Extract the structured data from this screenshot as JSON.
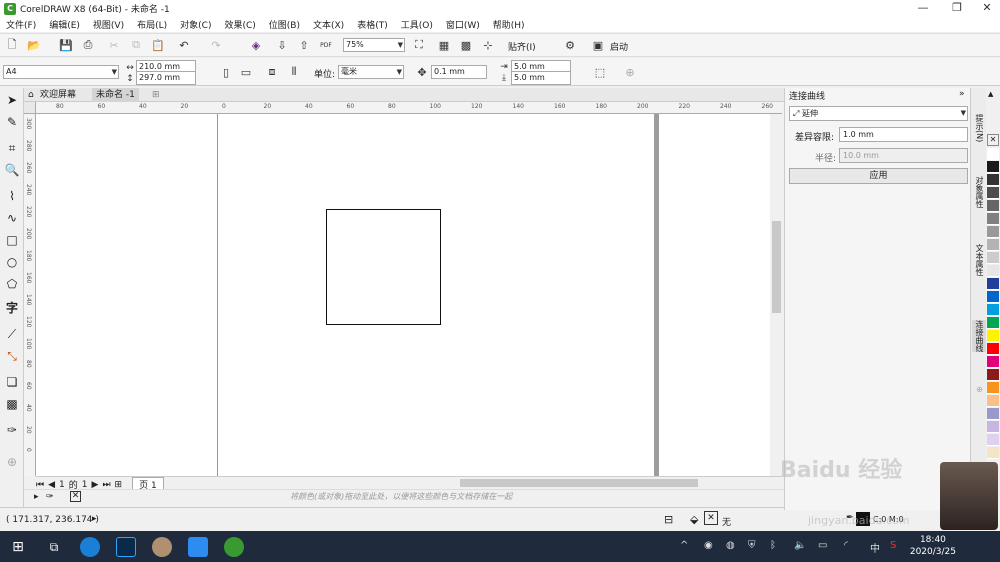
{
  "window": {
    "title": "CorelDRAW X8 (64-Bit) - 未命名 -1",
    "logo": "C"
  },
  "menu": [
    "文件(F)",
    "编辑(E)",
    "视图(V)",
    "布局(L)",
    "对象(C)",
    "效果(C)",
    "位图(B)",
    "文本(X)",
    "表格(T)",
    "工具(O)",
    "窗口(W)",
    "帮助(H)"
  ],
  "toolbar1": {
    "zoom": "75%",
    "snap_label": "贴齐(I)",
    "launch_label": "启动",
    "pdf_label": "PDF"
  },
  "toolbar2": {
    "page_size": "A4",
    "width": "210.0 mm",
    "height": "297.0 mm",
    "units_label": "单位:",
    "units": "毫米",
    "nudge": "0.1 mm",
    "dup_x": "5.0 mm",
    "dup_y": "5.0 mm"
  },
  "tabs": {
    "welcome": "欢迎屏幕",
    "doc": "未命名 -1"
  },
  "hruler_labels": [
    "80",
    "60",
    "40",
    "20",
    "0",
    "20",
    "40",
    "60",
    "80",
    "100",
    "120",
    "140",
    "160",
    "180",
    "200",
    "220",
    "240",
    "260"
  ],
  "vruler_labels": [
    "300",
    "280",
    "260",
    "240",
    "220",
    "200",
    "180",
    "160",
    "140",
    "120",
    "100",
    "80",
    "60",
    "40",
    "20",
    "0"
  ],
  "pagenav": {
    "current": "1",
    "of": "的",
    "total": "1",
    "page_tab": "页 1"
  },
  "hint": "将颜色(或对象)拖动至此处，以便将这些颜色与文档存储在一起",
  "status": {
    "coords": "( 171.317, 236.174 )",
    "fill_none": "无",
    "color_info": "C:0 M:0"
  },
  "docker": {
    "title": "连接曲线",
    "mode": "延伸",
    "tolerance_label": "差异容限:",
    "tolerance": "1.0 mm",
    "radius_label": "半径:",
    "radius": "10.0 mm",
    "apply": "应用"
  },
  "vtabs": [
    "提示(N)",
    "对象属性",
    "文本属性",
    "连接曲线"
  ],
  "palette": [
    "#ffffff",
    "#1a1a1a",
    "#333333",
    "#4d4d4d",
    "#666666",
    "#808080",
    "#999999",
    "#b3b3b3",
    "#cccccc",
    "#e6e6e6",
    "#1f3f99",
    "#0066cc",
    "#00a0e0",
    "#00a651",
    "#fff200",
    "#ff0000",
    "#e0007a",
    "#8b1a1a",
    "#f7941d",
    "#f9c08a",
    "#9999cc",
    "#c8b6e2",
    "#e0d0f0",
    "#f3e5c8"
  ],
  "watermark": {
    "text": "Baidu 经验",
    "url": "jingyan.baidu.com"
  },
  "taskbar": {
    "time": "18:40",
    "date": "2020/3/25",
    "ime": "中"
  }
}
